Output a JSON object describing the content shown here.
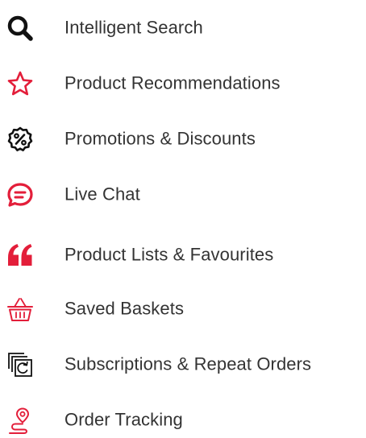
{
  "colors": {
    "accent": "#e31e3a",
    "dark": "#111111",
    "text": "#333333",
    "background": "#ffffff"
  },
  "features": [
    {
      "label": "Intelligent Search",
      "icon": "search-icon",
      "color": "#111111"
    },
    {
      "label": "Product Recommendations",
      "icon": "star-icon",
      "color": "#e31e3a"
    },
    {
      "label": "Promotions & Discounts",
      "icon": "percent-badge-icon",
      "color": "#111111"
    },
    {
      "label": "Live Chat",
      "icon": "chat-bubble-icon",
      "color": "#e31e3a"
    },
    {
      "label": "Product Lists & Favourites",
      "icon": "quote-icon",
      "color": "#e31e3a"
    },
    {
      "label": "Saved Baskets",
      "icon": "basket-icon",
      "color": "#e31e3a"
    },
    {
      "label": "Subscriptions & Repeat Orders",
      "icon": "repeat-copy-icon",
      "color": "#111111"
    },
    {
      "label": "Order Tracking",
      "icon": "location-route-icon",
      "color": "#e31e3a"
    }
  ]
}
